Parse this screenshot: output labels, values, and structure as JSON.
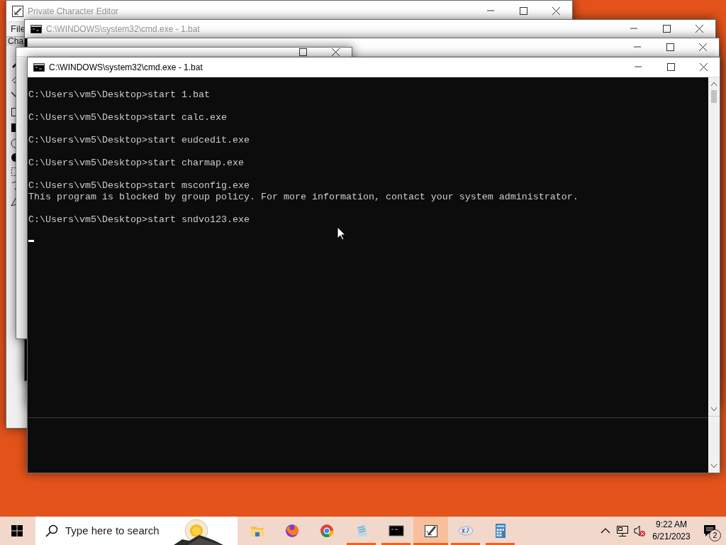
{
  "windows": [
    {
      "kind": "editor",
      "title": "Private Character Editor",
      "active": false,
      "menu": [
        "File"
      ],
      "field_label": "Cha"
    },
    {
      "kind": "console",
      "title": "C:\\WINDOWS\\system32\\cmd.exe - 1.bat",
      "active": false
    },
    {
      "kind": "console"
    },
    {
      "kind": "charmap"
    },
    {
      "kind": "console",
      "title": "C:\\WINDOWS\\system32\\cmd.exe - 1.bat",
      "active": true,
      "console_groups": [
        [
          "C:\\Users\\vm5\\Desktop>start 1.bat"
        ],
        [
          "C:\\Users\\vm5\\Desktop>start calc.exe"
        ],
        [
          "C:\\Users\\vm5\\Desktop>start eudcedit.exe"
        ],
        [
          "C:\\Users\\vm5\\Desktop>start charmap.exe"
        ],
        [
          "C:\\Users\\vm5\\Desktop>start msconfig.exe",
          "This program is blocked by group policy. For more information, contact your system administrator."
        ],
        [
          "C:\\Users\\vm5\\Desktop>start sndvo123.exe"
        ]
      ]
    }
  ],
  "taskbar": {
    "search": {
      "placeholder": "Type here to search"
    },
    "apps": [
      {
        "selected": false,
        "running": false
      },
      {
        "selected": false,
        "running": false
      },
      {
        "selected": false,
        "running": false
      },
      {
        "selected": false,
        "running": true
      },
      {
        "selected": false,
        "running": true
      },
      {
        "selected": true,
        "running": true
      },
      {
        "selected": false,
        "running": true
      },
      {
        "selected": false,
        "running": true
      }
    ],
    "clock": {
      "time": "9:22 AM",
      "date": "6/21/2023"
    },
    "notifications": "2"
  }
}
